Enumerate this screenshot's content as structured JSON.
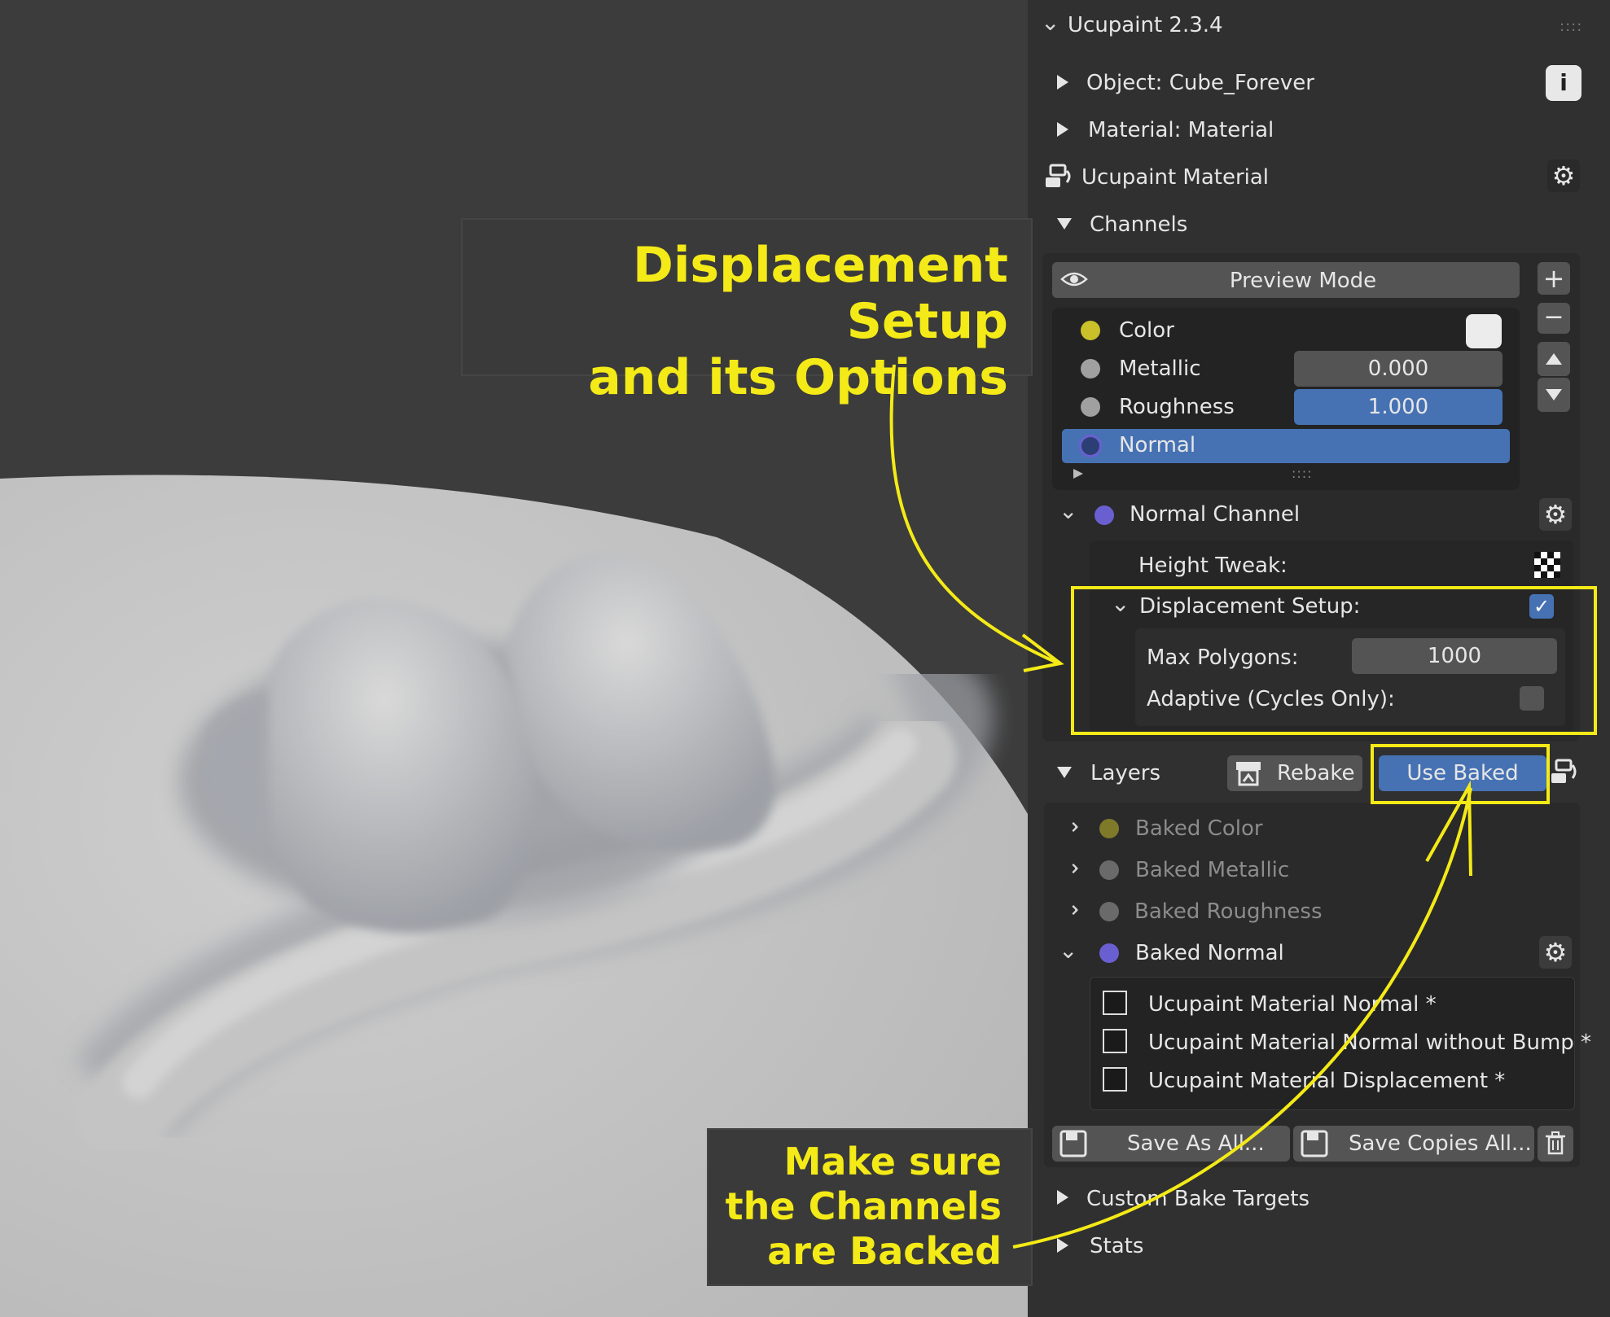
{
  "addon_title": "Ucupaint 2.3.4",
  "object_row": "Object: Cube_Forever",
  "material_row": "Material: Material",
  "ucupaint_material": "Ucupaint Material",
  "channels_header": "Channels",
  "preview_mode": "Preview Mode",
  "channels": [
    {
      "name": "Color",
      "color": "#c9c02a",
      "value": ""
    },
    {
      "name": "Metallic",
      "color": "#a0a0a0",
      "value": "0.000"
    },
    {
      "name": "Roughness",
      "color": "#a0a0a0",
      "value": "1.000"
    },
    {
      "name": "Normal",
      "color": "#6a5fd0",
      "value": ""
    }
  ],
  "normal_channel": {
    "title": "Normal Channel",
    "height_tweak": "Height Tweak:",
    "displacement_setup": "Displacement Setup:",
    "displacement_enabled": true,
    "max_polygons_label": "Max Polygons:",
    "max_polygons_value": "1000",
    "adaptive_label": "Adaptive (Cycles Only):",
    "adaptive_enabled": false
  },
  "layers": {
    "header": "Layers",
    "rebake": "Rebake",
    "use_baked": "Use Baked",
    "items": [
      {
        "name": "Baked Color",
        "color": "#7f7a2a"
      },
      {
        "name": "Baked Metallic",
        "color": "#6a6a6a"
      },
      {
        "name": "Baked Roughness",
        "color": "#6a6a6a"
      },
      {
        "name": "Baked Normal",
        "color": "#6a5fd0"
      }
    ],
    "images": [
      "Ucupaint Material Normal *",
      "Ucupaint Material Normal without Bump *",
      "Ucupaint Material Displacement *"
    ],
    "save_as_all": "Save As All...",
    "save_copies_all": "Save Copies All..."
  },
  "custom_bake_targets": "Custom Bake Targets",
  "stats": "Stats",
  "annotations": {
    "top_line1": "Displacement Setup",
    "top_line2": "and its Options",
    "bottom_line1": "Make sure",
    "bottom_line2": "the Channels",
    "bottom_line3": "are Backed",
    "highlight_color": "#f4ea17"
  }
}
